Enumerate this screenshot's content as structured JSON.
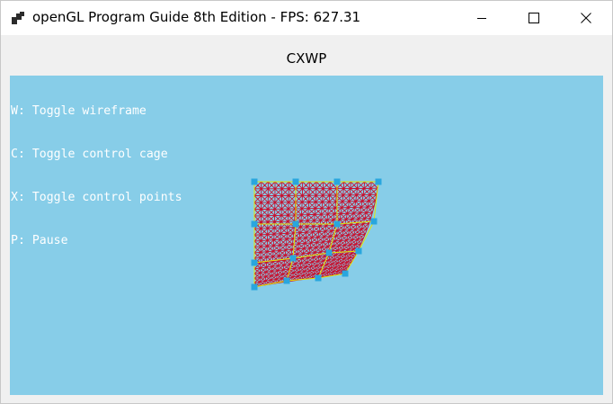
{
  "window": {
    "title": "openGL Program Guide 8th Edition - FPS: 627.31",
    "icons": {
      "app": "app-icon",
      "minimize": "minimize-icon",
      "maximize": "maximize-icon",
      "close": "close-icon"
    }
  },
  "form": {
    "title": "CXWP"
  },
  "viewport": {
    "background": "#87cde8",
    "help_lines": [
      "W: Toggle wireframe",
      "C: Toggle control cage",
      "X: Toggle control points",
      "P: Pause"
    ],
    "colors": {
      "wireframe": "#c8102e",
      "cage": "#e6e600",
      "control_point": "#29a6de"
    }
  }
}
